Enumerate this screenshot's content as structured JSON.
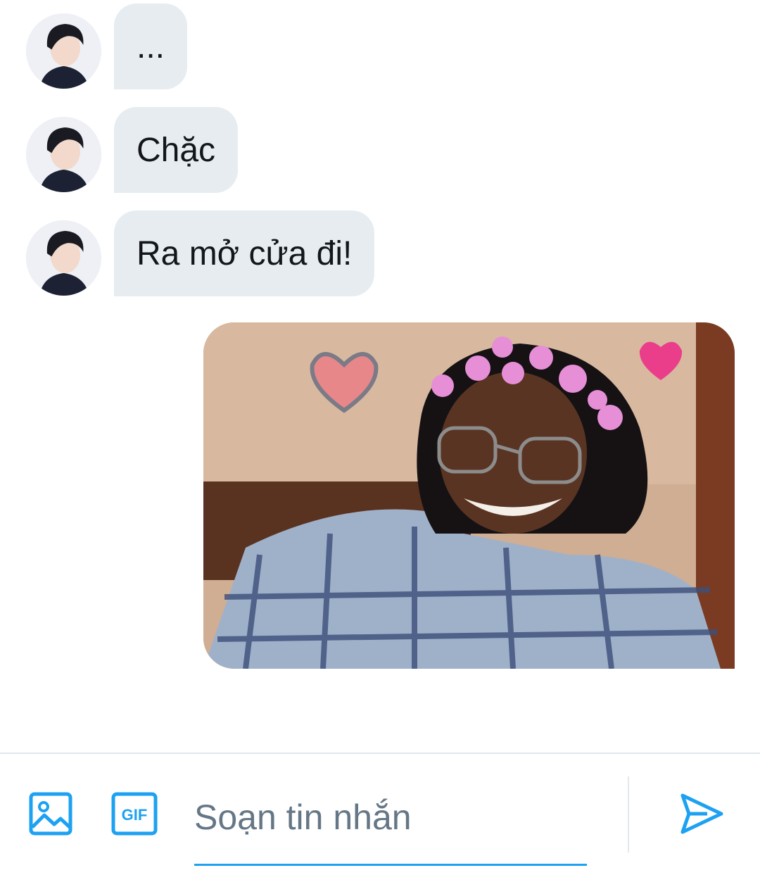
{
  "messages": [
    {
      "sender": "other",
      "text": "..."
    },
    {
      "sender": "other",
      "text": "Chặc"
    },
    {
      "sender": "other",
      "text": "Ra mở cửa đi!"
    }
  ],
  "sent_image": {
    "kind": "photo",
    "description_icon": "photo-message"
  },
  "compose": {
    "placeholder": "Soạn tin nhắn",
    "value": "",
    "gif_label": "GIF"
  },
  "icons": {
    "image": "image-icon",
    "gif": "gif-icon",
    "send": "send-icon"
  },
  "colors": {
    "accent": "#1da1f2",
    "bubble": "#e6ecf0",
    "text": "#14171a",
    "placeholder": "#657786"
  }
}
